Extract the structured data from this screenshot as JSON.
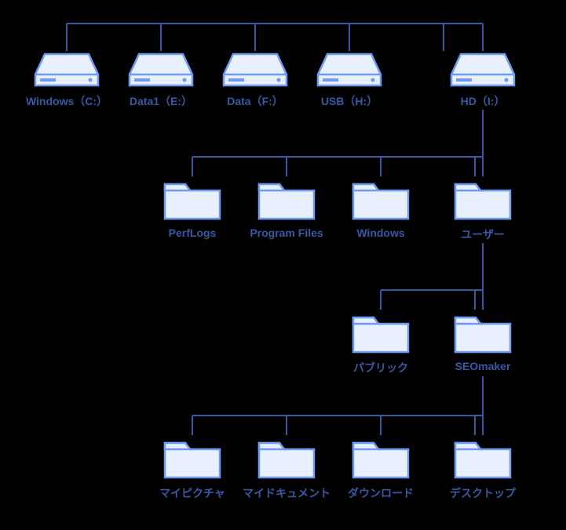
{
  "tree": {
    "drives": [
      {
        "id": "c",
        "label": "Windows（C:）"
      },
      {
        "id": "e",
        "label": "Data1（E:）"
      },
      {
        "id": "f",
        "label": "Data（F:）"
      },
      {
        "id": "h",
        "label": "USB（H:）"
      },
      {
        "id": "i",
        "label": "HD（I:）"
      }
    ],
    "level2": [
      {
        "id": "perflogs",
        "label": "PerfLogs"
      },
      {
        "id": "progfiles",
        "label": "Program Files"
      },
      {
        "id": "windows",
        "label": "Windows"
      },
      {
        "id": "users",
        "label": "ユーザー"
      }
    ],
    "level3": [
      {
        "id": "public",
        "label": "パブリック"
      },
      {
        "id": "seomaker",
        "label": "SEOmaker"
      }
    ],
    "level4": [
      {
        "id": "mypic",
        "label": "マイピクチャ"
      },
      {
        "id": "mydoc",
        "label": "マイドキュメント"
      },
      {
        "id": "download",
        "label": "ダウンロード"
      },
      {
        "id": "desktop",
        "label": "デスクトップ"
      }
    ]
  },
  "colors": {
    "line": "#3859a6",
    "iconStroke": "#6f9bf2",
    "iconFill": "#e8f0fd",
    "label": "#3859a6",
    "bg": "#000000"
  },
  "layout": {
    "driveY": 70,
    "driveX": [
      85,
      205,
      325,
      445,
      565
    ],
    "level2Y": 230,
    "level2X": [
      245,
      365,
      485,
      605
    ],
    "level3Y": 400,
    "level3X": [
      485,
      605
    ],
    "level4Y": 560,
    "level4X": [
      245,
      365,
      485,
      605
    ]
  }
}
